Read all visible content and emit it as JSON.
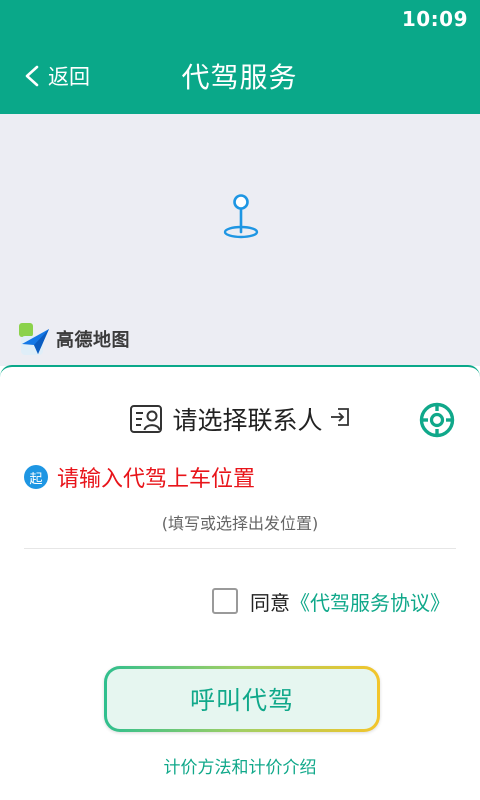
{
  "status_bar": {
    "time": "10:09"
  },
  "header": {
    "back_label": "返回",
    "title": "代驾服务",
    "background_color": "#0aa889"
  },
  "map": {
    "provider_logo_text": "高德地图",
    "pin_color": "#1e96e3"
  },
  "panel": {
    "contact_label": "请选择联系人",
    "start_badge": "起",
    "start_placeholder": "请输入代驾上车位置",
    "start_hint": "(填写或选择出发位置)",
    "agree_prefix": "同意",
    "agreement_link": "《代驾服务协议》",
    "agreement_checked": false,
    "call_button": "呼叫代驾",
    "pricing_link": "计价方法和计价介绍"
  },
  "colors": {
    "accent": "#0aa889",
    "link": "#10a88a",
    "warning_text": "#e8141a",
    "badge_blue": "#1e96e3"
  }
}
